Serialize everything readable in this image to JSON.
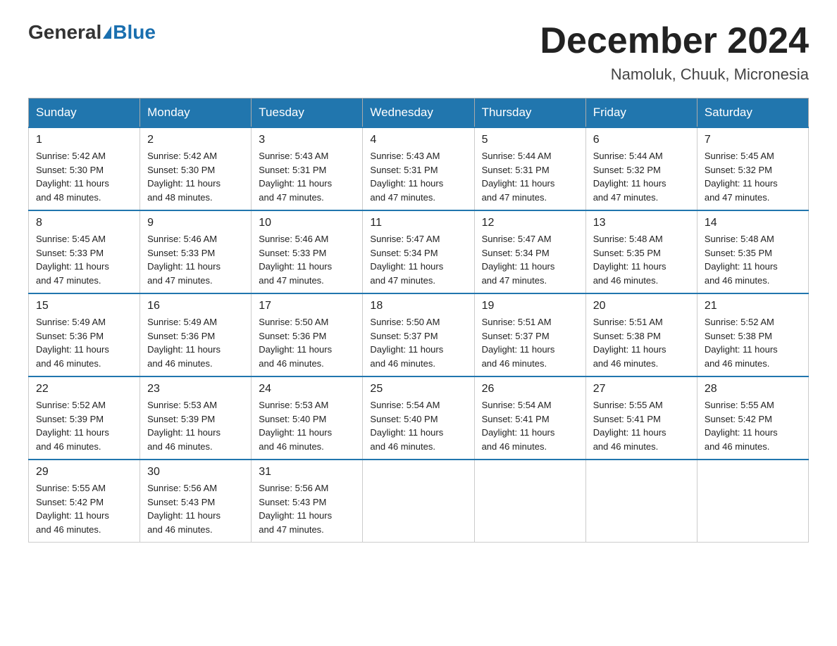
{
  "header": {
    "logo_general": "General",
    "logo_blue": "Blue",
    "title": "December 2024",
    "subtitle": "Namoluk, Chuuk, Micronesia"
  },
  "days_of_week": [
    "Sunday",
    "Monday",
    "Tuesday",
    "Wednesday",
    "Thursday",
    "Friday",
    "Saturday"
  ],
  "weeks": [
    [
      {
        "day": "1",
        "sunrise": "5:42 AM",
        "sunset": "5:30 PM",
        "daylight": "11 hours and 48 minutes."
      },
      {
        "day": "2",
        "sunrise": "5:42 AM",
        "sunset": "5:30 PM",
        "daylight": "11 hours and 48 minutes."
      },
      {
        "day": "3",
        "sunrise": "5:43 AM",
        "sunset": "5:31 PM",
        "daylight": "11 hours and 47 minutes."
      },
      {
        "day": "4",
        "sunrise": "5:43 AM",
        "sunset": "5:31 PM",
        "daylight": "11 hours and 47 minutes."
      },
      {
        "day": "5",
        "sunrise": "5:44 AM",
        "sunset": "5:31 PM",
        "daylight": "11 hours and 47 minutes."
      },
      {
        "day": "6",
        "sunrise": "5:44 AM",
        "sunset": "5:32 PM",
        "daylight": "11 hours and 47 minutes."
      },
      {
        "day": "7",
        "sunrise": "5:45 AM",
        "sunset": "5:32 PM",
        "daylight": "11 hours and 47 minutes."
      }
    ],
    [
      {
        "day": "8",
        "sunrise": "5:45 AM",
        "sunset": "5:33 PM",
        "daylight": "11 hours and 47 minutes."
      },
      {
        "day": "9",
        "sunrise": "5:46 AM",
        "sunset": "5:33 PM",
        "daylight": "11 hours and 47 minutes."
      },
      {
        "day": "10",
        "sunrise": "5:46 AM",
        "sunset": "5:33 PM",
        "daylight": "11 hours and 47 minutes."
      },
      {
        "day": "11",
        "sunrise": "5:47 AM",
        "sunset": "5:34 PM",
        "daylight": "11 hours and 47 minutes."
      },
      {
        "day": "12",
        "sunrise": "5:47 AM",
        "sunset": "5:34 PM",
        "daylight": "11 hours and 47 minutes."
      },
      {
        "day": "13",
        "sunrise": "5:48 AM",
        "sunset": "5:35 PM",
        "daylight": "11 hours and 46 minutes."
      },
      {
        "day": "14",
        "sunrise": "5:48 AM",
        "sunset": "5:35 PM",
        "daylight": "11 hours and 46 minutes."
      }
    ],
    [
      {
        "day": "15",
        "sunrise": "5:49 AM",
        "sunset": "5:36 PM",
        "daylight": "11 hours and 46 minutes."
      },
      {
        "day": "16",
        "sunrise": "5:49 AM",
        "sunset": "5:36 PM",
        "daylight": "11 hours and 46 minutes."
      },
      {
        "day": "17",
        "sunrise": "5:50 AM",
        "sunset": "5:36 PM",
        "daylight": "11 hours and 46 minutes."
      },
      {
        "day": "18",
        "sunrise": "5:50 AM",
        "sunset": "5:37 PM",
        "daylight": "11 hours and 46 minutes."
      },
      {
        "day": "19",
        "sunrise": "5:51 AM",
        "sunset": "5:37 PM",
        "daylight": "11 hours and 46 minutes."
      },
      {
        "day": "20",
        "sunrise": "5:51 AM",
        "sunset": "5:38 PM",
        "daylight": "11 hours and 46 minutes."
      },
      {
        "day": "21",
        "sunrise": "5:52 AM",
        "sunset": "5:38 PM",
        "daylight": "11 hours and 46 minutes."
      }
    ],
    [
      {
        "day": "22",
        "sunrise": "5:52 AM",
        "sunset": "5:39 PM",
        "daylight": "11 hours and 46 minutes."
      },
      {
        "day": "23",
        "sunrise": "5:53 AM",
        "sunset": "5:39 PM",
        "daylight": "11 hours and 46 minutes."
      },
      {
        "day": "24",
        "sunrise": "5:53 AM",
        "sunset": "5:40 PM",
        "daylight": "11 hours and 46 minutes."
      },
      {
        "day": "25",
        "sunrise": "5:54 AM",
        "sunset": "5:40 PM",
        "daylight": "11 hours and 46 minutes."
      },
      {
        "day": "26",
        "sunrise": "5:54 AM",
        "sunset": "5:41 PM",
        "daylight": "11 hours and 46 minutes."
      },
      {
        "day": "27",
        "sunrise": "5:55 AM",
        "sunset": "5:41 PM",
        "daylight": "11 hours and 46 minutes."
      },
      {
        "day": "28",
        "sunrise": "5:55 AM",
        "sunset": "5:42 PM",
        "daylight": "11 hours and 46 minutes."
      }
    ],
    [
      {
        "day": "29",
        "sunrise": "5:55 AM",
        "sunset": "5:42 PM",
        "daylight": "11 hours and 46 minutes."
      },
      {
        "day": "30",
        "sunrise": "5:56 AM",
        "sunset": "5:43 PM",
        "daylight": "11 hours and 46 minutes."
      },
      {
        "day": "31",
        "sunrise": "5:56 AM",
        "sunset": "5:43 PM",
        "daylight": "11 hours and 47 minutes."
      },
      null,
      null,
      null,
      null
    ]
  ],
  "labels": {
    "sunrise": "Sunrise:",
    "sunset": "Sunset:",
    "daylight": "Daylight:"
  }
}
